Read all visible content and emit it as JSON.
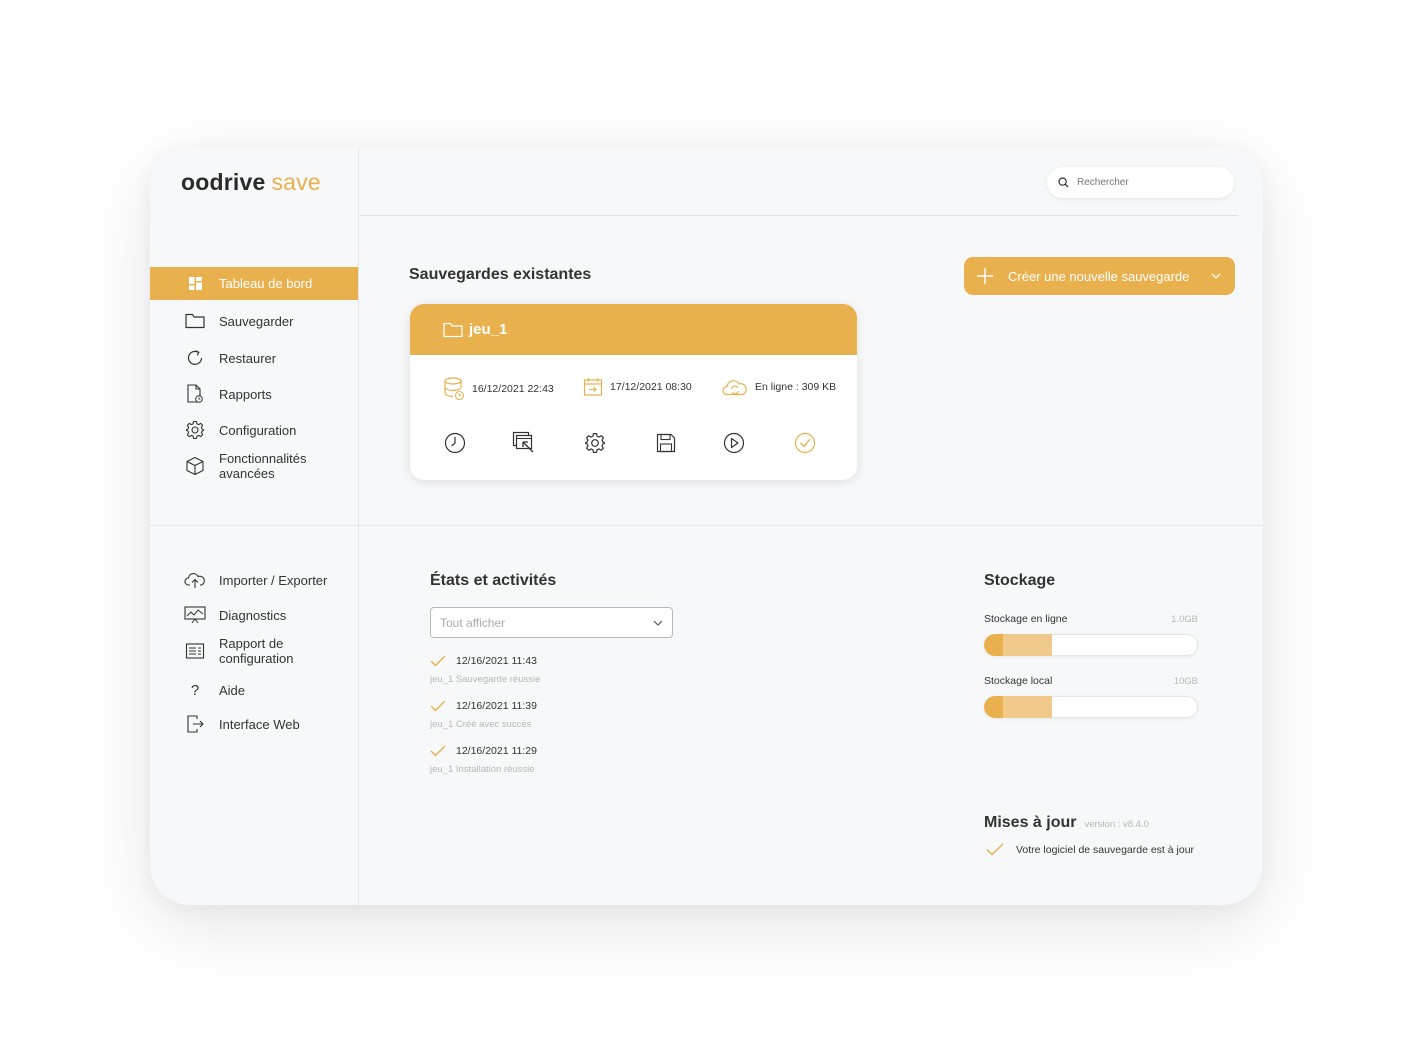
{
  "brand": {
    "name": "oodrive",
    "product": "save"
  },
  "colors": {
    "accent": "#e9b04e",
    "accent_light": "#f1c98a",
    "muted": "#b4b7bb"
  },
  "search": {
    "placeholder": "Rechercher",
    "icon": "search-icon"
  },
  "nav_main": [
    {
      "label": "Tableau de bord",
      "icon": "dashboard-icon",
      "active": true
    },
    {
      "label": "Sauvegarder",
      "icon": "folder-icon"
    },
    {
      "label": "Restaurer",
      "icon": "refresh-icon"
    },
    {
      "label": "Rapports",
      "icon": "report-icon"
    },
    {
      "label": "Configuration",
      "icon": "gear-icon"
    },
    {
      "label": "Fonctionnalités avancées",
      "icon": "cube-icon"
    }
  ],
  "nav_secondary": [
    {
      "label": "Importer / Exporter",
      "icon": "cloud-upload-icon"
    },
    {
      "label": "Diagnostics",
      "icon": "chart-icon"
    },
    {
      "label": "Rapport de configuration",
      "icon": "config-report-icon"
    },
    {
      "label": "Aide",
      "icon": "help-icon"
    },
    {
      "label": "Interface Web",
      "icon": "logout-icon"
    }
  ],
  "backups": {
    "title": "Sauvegardes existantes",
    "create_label": "Créer une nouvelle sauvegarde",
    "card": {
      "name": "jeu_1",
      "last_backup": "16/12/2021 22:43",
      "next_backup": "17/12/2021 08:30",
      "online": "En ligne : 309 KB",
      "actions": [
        "clock-icon",
        "restore-window-icon",
        "gear-icon",
        "save-icon",
        "play-icon",
        "check-circle-icon"
      ]
    }
  },
  "activities": {
    "title": "États et activités",
    "filter": "Tout afficher",
    "items": [
      {
        "date": "12/16/2021 11:43",
        "desc": "jeu_1 Sauvegarde réussie"
      },
      {
        "date": "12/16/2021 11:39",
        "desc": "jeu_1 Créé avec succès"
      },
      {
        "date": "12/16/2021 11:29",
        "desc": "jeu_1 Installation réussie"
      }
    ]
  },
  "storage": {
    "title": "Stockage",
    "online": {
      "label": "Stockage en ligne",
      "capacity": "1.0GB",
      "used_fraction": 0.32,
      "core_fraction": 0.09
    },
    "local": {
      "label": "Stockage local",
      "capacity": "10GB",
      "used_fraction": 0.32,
      "core_fraction": 0.09
    }
  },
  "updates": {
    "title": "Mises à jour",
    "version": "version : v8.4.0",
    "message": "Votre logiciel de sauvegarde est à jour"
  }
}
